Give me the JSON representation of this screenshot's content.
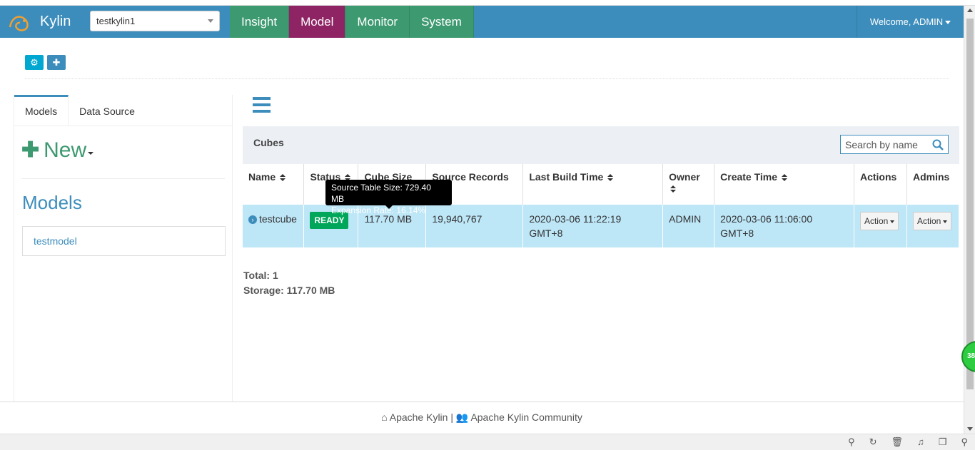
{
  "navbar": {
    "brand": "Kylin",
    "project": "testkylin1",
    "menu": [
      "Insight",
      "Model",
      "Monitor",
      "System"
    ],
    "active_menu": "Model",
    "welcome": "Welcome, ADMIN"
  },
  "left": {
    "tabs": [
      "Models",
      "Data Source"
    ],
    "new_label": "New",
    "models_title": "Models",
    "models": [
      "testmodel"
    ]
  },
  "cubes": {
    "title": "Cubes",
    "search_placeholder": "Search by name",
    "columns": [
      "Name",
      "Status",
      "Cube Size",
      "Source Records",
      "Last Build Time",
      "Owner",
      "Create Time",
      "Actions",
      "Admins"
    ],
    "rows": [
      {
        "name": "testcube",
        "status": "READY",
        "cube_size": "117.70 MB",
        "source_records": "19,940,767",
        "last_build_time": "2020-03-06 11:22:19 GMT+8",
        "owner": "ADMIN",
        "create_time": "2020-03-06 11:06:00 GMT+8",
        "actions": "Action",
        "admins": "Action"
      }
    ],
    "tooltip_line1": "Source Table Size: 729.40 MB",
    "tooltip_line2": "Expansion Rate: 16.14%",
    "total": "Total: 1",
    "storage": "Storage: 117.70 MB"
  },
  "footer": {
    "link1": "Apache Kylin",
    "separator": "|",
    "link2": "Apache Kylin Community"
  },
  "badge": "38",
  "colors": {
    "navbar": "#3c8dbc",
    "menu": "#3d9970",
    "menu_active": "#8e2464",
    "selected_row": "#bde6f7",
    "ready": "#00a65a"
  }
}
